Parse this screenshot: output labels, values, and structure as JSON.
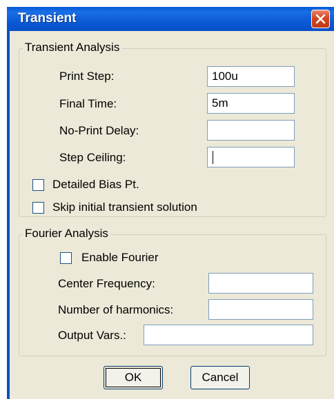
{
  "window": {
    "title": "Transient"
  },
  "transient_analysis": {
    "legend": "Transient Analysis",
    "print_step": {
      "label": "Print Step:",
      "value": "100u"
    },
    "final_time": {
      "label": "Final Time:",
      "value": "5m"
    },
    "no_print_delay": {
      "label": "No-Print Delay:",
      "value": ""
    },
    "step_ceiling": {
      "label": "Step Ceiling:",
      "value": ""
    },
    "detailed_bias": {
      "label": "Detailed Bias Pt.",
      "checked": false
    },
    "skip_initial": {
      "label": "Skip initial transient solution",
      "checked": false
    }
  },
  "fourier_analysis": {
    "legend": "Fourier Analysis",
    "enable_fourier": {
      "label": "Enable Fourier",
      "checked": false
    },
    "center_frequency": {
      "label": "Center Frequency:",
      "value": ""
    },
    "num_harmonics": {
      "label": "Number of harmonics:",
      "value": ""
    },
    "output_vars": {
      "label": "Output Vars.:",
      "value": ""
    }
  },
  "buttons": {
    "ok": "OK",
    "cancel": "Cancel"
  },
  "icons": {
    "close": "close-icon"
  },
  "colors": {
    "titlebar": "#0A5BD4",
    "dialog_bg": "#ECE9D8",
    "close_button": "#D2461F"
  }
}
